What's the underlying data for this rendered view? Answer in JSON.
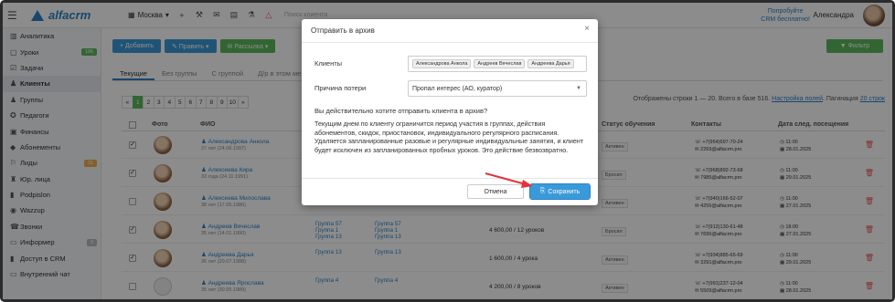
{
  "app": {
    "brand": "alfacrm",
    "branch": "Москва",
    "search_placeholder": "Поиск клиента",
    "promo_line1": "Попробуйте",
    "promo_line2": "CRM бесплатно!",
    "user_name": "Александра"
  },
  "sidebar": {
    "items": [
      {
        "label": "Аналитика",
        "icon": "analytics-icon"
      },
      {
        "label": "Уроки",
        "icon": "lessons-icon",
        "badge": "106"
      },
      {
        "label": "Задачи",
        "icon": "tasks-icon"
      },
      {
        "label": "Клиенты",
        "icon": "clients-icon",
        "active": true
      },
      {
        "label": "Группы",
        "icon": "groups-icon"
      },
      {
        "label": "Педагоги",
        "icon": "teachers-icon"
      },
      {
        "label": "Финансы",
        "icon": "finance-icon"
      },
      {
        "label": "Абонементы",
        "icon": "subscriptions-icon"
      },
      {
        "label": "Лиды",
        "icon": "leads-icon",
        "badge": "31"
      },
      {
        "label": "Юр. лица",
        "icon": "legal-icon"
      },
      {
        "label": "Podpislon",
        "icon": "podpislon-icon"
      },
      {
        "label": "Wazzup",
        "icon": "wazzup-icon"
      },
      {
        "label": "Звонки",
        "icon": "calls-icon"
      },
      {
        "label": "Информер",
        "icon": "informer-icon",
        "badge": "0"
      },
      {
        "label": "Доступ в CRM",
        "icon": "access-icon"
      },
      {
        "label": "Внутренний чат",
        "icon": "chat-icon"
      }
    ]
  },
  "toolbar": {
    "add_label": "+ Добавить",
    "edit_label": "✎ Править ▾",
    "mailing_label": "✉ Рассылка ▾",
    "filter_label": "▼ Фильтр"
  },
  "tabs": [
    "Текущие",
    "Без группы",
    "С группой",
    "Д/р в этом ме"
  ],
  "pagination": [
    "«",
    "1",
    "2",
    "3",
    "4",
    "5",
    "6",
    "7",
    "8",
    "9",
    "10",
    "»"
  ],
  "rows_info": {
    "text": "Отображены строки 1 — 20. Всего в базе 516.",
    "settings_link": "Настройка полей",
    "pagination_label": "Пагинация",
    "per_page_link": "20 строк"
  },
  "table": {
    "headers": {
      "photo": "Фото",
      "name": "ФИО",
      "status": "Статус обучения",
      "contacts": "Контакты",
      "next_date": "Дата след. посещения"
    },
    "rows": [
      {
        "checked": true,
        "name": "Александрова Анкола",
        "age": "27 лет (24.06.1997)",
        "group1": "",
        "group2": "",
        "balance": "",
        "status": "Активен",
        "phone": "+7(954)697-70-24",
        "email": "2269@alfacrm.pro",
        "time": "11:00",
        "date": "28.01.2025"
      },
      {
        "checked": true,
        "name": "Алексеева Кира",
        "age": "33 года (24.11.1991)",
        "group1": "",
        "group2": "",
        "balance": "",
        "status": "Бросил",
        "phone": "+7(968)892-73-68",
        "email": "7985@alfacrm.pro",
        "time": "11:00",
        "date": "29.01.2025"
      },
      {
        "checked": false,
        "name": "Алексеева Милослава",
        "age": "38 лет (17.05.1986)",
        "group1": "",
        "group2": "",
        "balance": "",
        "status": "Активен",
        "phone": "+7(940)166-52-07",
        "email": "4256@alfacrm.pro",
        "time": "11:00",
        "date": "27.01.2025"
      },
      {
        "checked": true,
        "name": "Андреев Вячеслав",
        "age": "35 лет (14.01.1990)",
        "group1": "Группа 57\nГруппа 1\nГруппа 13",
        "group2": "Группа 57\nГруппа 1\nГруппа 13",
        "balance": "4 600,00 / 12 уроков",
        "status": "Бросил",
        "phone": "+7(912)130-61-48",
        "email": "7696@alfacrm.pro",
        "time": "18:00",
        "date": "27.01.2025"
      },
      {
        "checked": true,
        "name": "Андреева Дарья",
        "age": "36 лет (20.07.1988)",
        "group1": "Группа 13",
        "group2": "Группа 13",
        "balance": "1 600,00 / 4 урока",
        "status": "Активен",
        "phone": "+7(934)885-65-69",
        "email": "3291@alfacrm.pro",
        "time": "11:00",
        "date": "29.01.2025"
      },
      {
        "checked": false,
        "name": "Андреева Ярослава",
        "age": "35 лет (30.05.1989)",
        "group1": "Группа 4",
        "group2": "Группа 4",
        "balance": "4 200,00 / 8 уроков",
        "status": "Активен",
        "phone": "+7(991)237-12-04",
        "email": "5509@alfacrm.pro",
        "time": "11:00",
        "date": "28.01.2025"
      }
    ]
  },
  "modal": {
    "title": "Отправить в архив",
    "clients_label": "Клиенты",
    "clients": [
      "Александрова Анкола",
      "Андреев Вячеслав",
      "Андреева Дарья"
    ],
    "reason_label": "Причина потери",
    "reason_value": "Пропал интерес (АО, куратор)",
    "question": "Вы действительно хотите отправить клиента в архив?",
    "description": "Текущим днем по клиенту ограничится период участия в группах, действия абонементов, скидок, приостановок, индивидуального регулярного расписания. Удаляется запланированные разовые и регулярные индивидуальные занятия, и клиент будет исключен из запланированных пробных уроков. Это действие безвозвратно.",
    "cancel_label": "Отмена",
    "save_label": "Сохранить"
  },
  "colors": {
    "brand": "#2c82c9",
    "add_button": "#3a9ad9",
    "edit_button": "#3a9ad9",
    "mailing_button": "#5cb85c",
    "filter_button": "#5cb85c",
    "annotation_arrow": "#e0343c"
  }
}
